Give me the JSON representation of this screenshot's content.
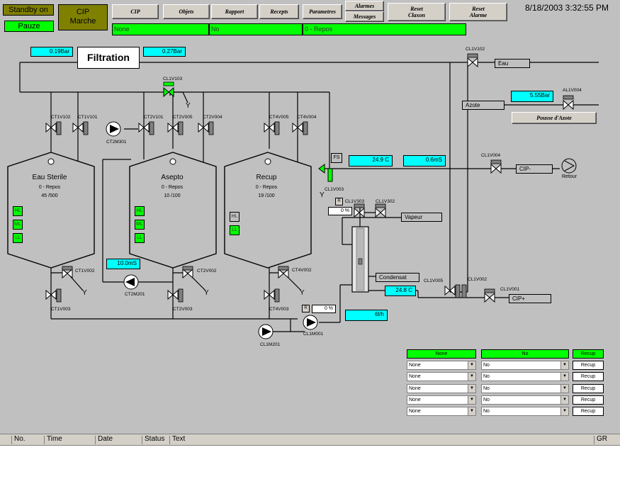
{
  "header": {
    "standby_label": "Standby on",
    "pause_label": "Pauze",
    "mode_label": "CIP\nMarche",
    "datetime": "8/18/2003 3:32:55 PM",
    "nav": [
      "CIP",
      "Objets",
      "Rapport",
      "Recepts",
      "Parametres"
    ],
    "alarmes_label": "Alarmes",
    "messages_label": "Messages",
    "reset_claxon": "Reset\nClaxon",
    "reset_alarme": "Reset\nAlarme",
    "status_fields": [
      "None",
      "No",
      "0 - Repos"
    ]
  },
  "process": {
    "title": "Filtration",
    "pressure_left": "0.19Bar",
    "pressure_right": "0.27Bar",
    "azote_pressure": "5.55Bar",
    "temp_top": "24.9 C",
    "conductivity_top": "0.6mS",
    "temp_hx": "24.8 C",
    "conductivity_bottom": "10.0mS",
    "flow": "6l/h",
    "valve_open_1": "0 %",
    "valve_open_2": "0 %",
    "fs_label": "FS",
    "r_label": "R",
    "y_label": "Y",
    "lines": {
      "eau": "Eau",
      "azote": "Azote",
      "pousse_azote": "Pousse d'Azote",
      "cip_minus": "CIP-",
      "cip_plus": "CIP+",
      "vapeur": "Vapeur",
      "condensat": "Condensat",
      "retour": "Retour"
    },
    "tanks": [
      {
        "name": "Eau Sterile",
        "state": "0 - Repos",
        "level": "45   /500",
        "levels": [
          "HL",
          "ML",
          "LL"
        ]
      },
      {
        "name": "Asepto",
        "state": "0 - Repos",
        "level": "10   /100",
        "levels": [
          "HL",
          "ML",
          "LL"
        ]
      },
      {
        "name": "Recup",
        "state": "0 - Repos",
        "level": "19   /100",
        "levels": [
          "HL",
          "LL"
        ]
      }
    ],
    "tags": {
      "ct1v102": "CT1V102",
      "ct1v101": "CT1V101",
      "ct2v101": "CT2V101",
      "ct2v005": "CT2V005",
      "ct2v004": "CT2V004",
      "ct4v005": "CT4V005",
      "ct4v004": "CT4V004",
      "cl1v103": "CL1V103",
      "cl1v102": "CL1V102",
      "al1v004": "AL1V004",
      "ct2m301": "CT2M301",
      "cl1v004": "CL1V004",
      "cl1v003": "CL1V003",
      "cl1v303": "CL1V303",
      "cl1v302": "CL1V302",
      "ct1v002": "CT1V002",
      "ct2v002": "CT2V002",
      "ct4v002": "CT4V002",
      "ct1v003": "CT1V003",
      "ct2v003": "CT2V003",
      "ct4v003": "CT4V003",
      "ct2m201": "CT2M201",
      "cl1m001": "CL1M001",
      "cl1m201": "CL1M201",
      "cl1v005": "CL1V005",
      "cl1v002": "CL1V002",
      "cl1v001": "CL1V001"
    }
  },
  "recipe_panel": {
    "col1_header": "None",
    "col2_header": "No",
    "col3_header": "Recup",
    "rows": [
      {
        "a": "None",
        "b": "No",
        "btn": "Recup"
      },
      {
        "a": "None",
        "b": "No",
        "btn": "Recup"
      },
      {
        "a": "None",
        "b": "No",
        "btn": "Recup"
      },
      {
        "a": "None",
        "b": "No",
        "btn": "Recup"
      },
      {
        "a": "None",
        "b": "No",
        "btn": "Recup"
      }
    ]
  },
  "alarm_table": {
    "columns": [
      "No.",
      "Time",
      "Date",
      "Status",
      "Text",
      "GR"
    ]
  }
}
